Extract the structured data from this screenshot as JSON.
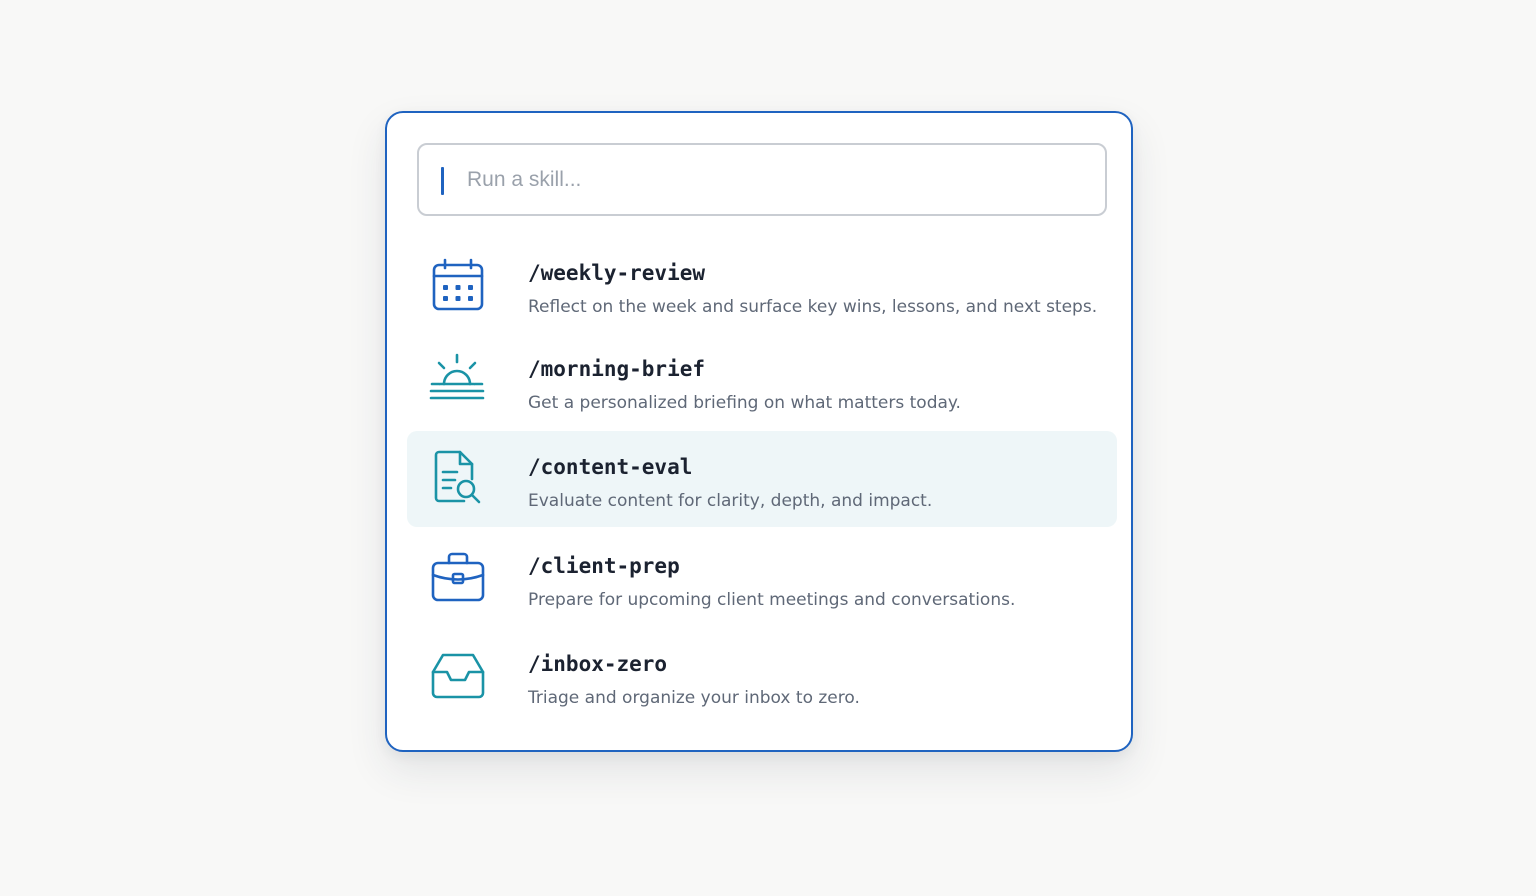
{
  "search": {
    "placeholder": "Run a skill..."
  },
  "colors": {
    "accent_blue": "#1f63c0",
    "accent_teal": "#1a93a6",
    "selected_bg": "#eef6f8"
  },
  "skills": [
    {
      "command": "/weekly-review",
      "description": "Reflect on the week and surface key wins, lessons, and next steps.",
      "icon": "calendar-icon",
      "selected": false
    },
    {
      "command": "/morning-brief",
      "description": "Get a personalized briefing on what matters today.",
      "icon": "sunrise-icon",
      "selected": false
    },
    {
      "command": "/content-eval",
      "description": "Evaluate content for clarity, depth, and impact.",
      "icon": "document-search-icon",
      "selected": true
    },
    {
      "command": "/client-prep",
      "description": "Prepare for upcoming client meetings and conversations.",
      "icon": "briefcase-icon",
      "selected": false
    },
    {
      "command": "/inbox-zero",
      "description": "Triage and organize your inbox to zero.",
      "icon": "inbox-tray-icon",
      "selected": false
    }
  ]
}
